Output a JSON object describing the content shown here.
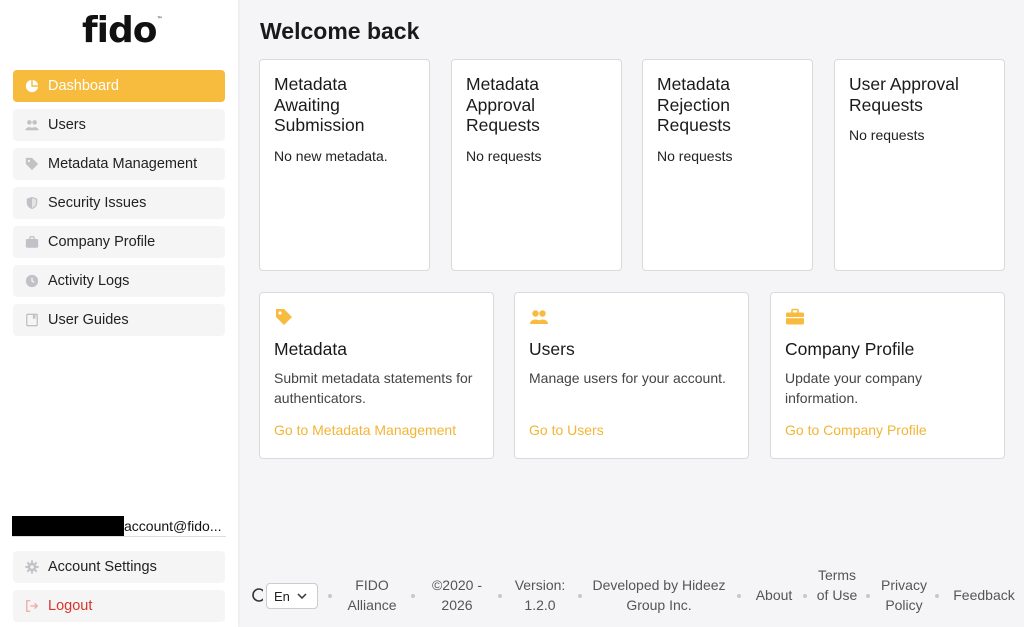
{
  "brand": {
    "name": "fido",
    "tm": "™"
  },
  "sidebar": {
    "items": [
      {
        "label": "Dashboard",
        "icon": "pie-chart-icon",
        "active": true
      },
      {
        "label": "Users",
        "icon": "users-icon"
      },
      {
        "label": "Metadata Management",
        "icon": "tag-icon"
      },
      {
        "label": "Security Issues",
        "icon": "shield-icon"
      },
      {
        "label": "Company Profile",
        "icon": "briefcase-icon"
      },
      {
        "label": "Activity Logs",
        "icon": "clock-icon"
      },
      {
        "label": "User Guides",
        "icon": "book-icon"
      }
    ],
    "user_email": "account@fido...",
    "account_settings": "Account Settings",
    "logout": "Logout"
  },
  "main": {
    "title": "Welcome back",
    "request_cards": [
      {
        "title": "Metadata Awaiting Submission",
        "status": "No new metadata."
      },
      {
        "title": "Metadata Approval Requests",
        "status": "No requests"
      },
      {
        "title": "Metadata Rejection Requests",
        "status": "No requests"
      },
      {
        "title": "User Approval Requests",
        "status": "No requests"
      }
    ],
    "feature_cards": [
      {
        "icon": "tag-icon",
        "title": "Metadata",
        "description": "Submit metadata statements for authenticators.",
        "link": "Go to Metadata Management"
      },
      {
        "icon": "users-icon",
        "title": "Users",
        "description": "Manage users for your account.",
        "link": "Go to Users"
      },
      {
        "icon": "briefcase-icon",
        "title": "Company Profile",
        "description": "Update your company information.",
        "link": "Go to Company Profile"
      }
    ]
  },
  "footer": {
    "language": "En",
    "org": "FIDO Alliance",
    "copyright": "©2020 - 2026",
    "version": "Version: 1.2.0",
    "developer": "Developed by Hideez Group Inc.",
    "about": "About",
    "terms": "Terms of Use",
    "privacy": "Privacy Policy",
    "feedback": "Feedback"
  },
  "colors": {
    "accent": "#f7bb3d",
    "link": "#f2b536",
    "danger": "#d9342b",
    "background": "#f5f5f7"
  }
}
